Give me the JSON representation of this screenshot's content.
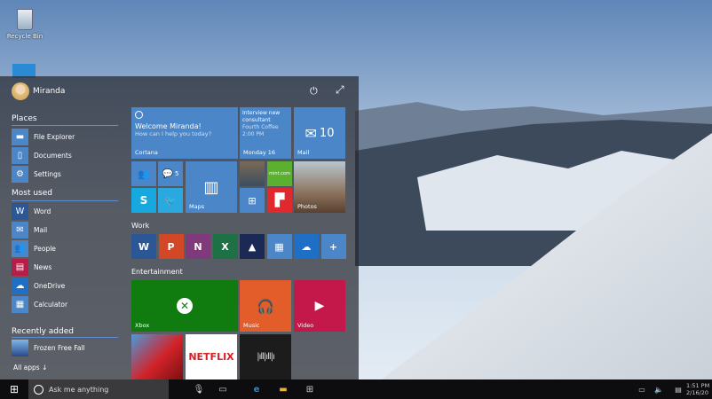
{
  "desktop": {
    "icons": [
      {
        "label": "Recycle Bin",
        "icon": "recycle-bin-icon"
      }
    ]
  },
  "start_menu": {
    "user": {
      "name": "Miranda"
    },
    "power_icon": "power-icon",
    "expand_icon": "expand-icon",
    "places": {
      "header": "Places",
      "items": [
        {
          "label": "File Explorer",
          "color": "#4a86c8"
        },
        {
          "label": "Documents",
          "color": "#4a86c8"
        },
        {
          "label": "Settings",
          "color": "#4a86c8"
        }
      ]
    },
    "most_used": {
      "header": "Most used",
      "items": [
        {
          "label": "Word",
          "color": "#2b5797"
        },
        {
          "label": "Mail",
          "color": "#4a86c8"
        },
        {
          "label": "People",
          "color": "#4a86c8"
        },
        {
          "label": "News",
          "color": "#b91d47"
        },
        {
          "label": "OneDrive",
          "color": "#1e6fc5"
        },
        {
          "label": "Calculator",
          "color": "#4a86c8"
        }
      ]
    },
    "recently_added": {
      "header": "Recently added",
      "items": [
        {
          "label": "Frozen Free Fall"
        }
      ]
    },
    "all_apps": "All apps",
    "all_apps_arrow": "↓",
    "tiles": {
      "cortana": {
        "title": "Welcome Miranda!",
        "subtitle": "How can I help you today?",
        "label": "Cortana"
      },
      "calendar": {
        "line1": "Interview new",
        "line2": "consultant",
        "line3": "Fourth Coffee",
        "line4": "2:00 PM",
        "label": "Monday 16"
      },
      "mail": {
        "count": "10",
        "label": "Mail"
      },
      "messaging_count": "5",
      "maps": {
        "label": "Maps"
      },
      "mint": {
        "text": "mint.com"
      },
      "photos": {
        "label": "Photos"
      }
    },
    "work": {
      "header": "Work",
      "tiles": [
        {
          "name": "word",
          "text": "W",
          "color": "#2b5797"
        },
        {
          "name": "powerpoint",
          "text": "P",
          "color": "#d24726"
        },
        {
          "name": "onenote",
          "text": "N",
          "color": "#80397b"
        },
        {
          "name": "excel",
          "text": "X",
          "color": "#1e7145"
        },
        {
          "name": "sway",
          "text": "▲",
          "color": "#1b2a55"
        },
        {
          "name": "calculator",
          "text": "▦",
          "color": "#4a86c8"
        },
        {
          "name": "onedrive",
          "text": "☁",
          "color": "#1e6fc5"
        },
        {
          "name": "add",
          "text": "+",
          "color": "#4a86c8"
        }
      ]
    },
    "entertainment": {
      "header": "Entertainment",
      "xbox": {
        "label": "Xbox",
        "color": "#107c10"
      },
      "music": {
        "label": "Music",
        "color": "#e25d2a"
      },
      "video": {
        "label": "Video",
        "color": "#c4174a"
      },
      "netflix": {
        "text": "NETFLIX"
      }
    }
  },
  "taskbar": {
    "search_placeholder": "Ask me anything",
    "clock": {
      "time": "1:51 PM",
      "date": "2/16/20"
    }
  }
}
